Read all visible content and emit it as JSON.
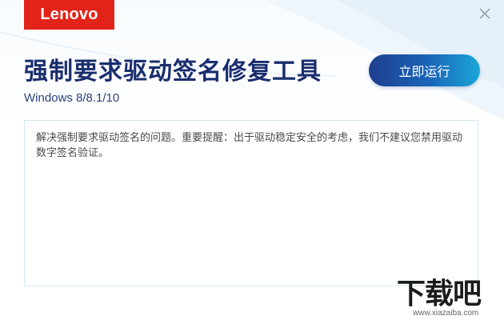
{
  "brand": {
    "logo_text": "Lenovo",
    "color": "#e2231a"
  },
  "window": {
    "close_icon": "close-icon"
  },
  "header": {
    "title": "强制要求驱动签名修复工具",
    "subtitle": "Windows 8/8.1/10"
  },
  "actions": {
    "run_label": "立即运行"
  },
  "info": {
    "text": "解决强制要求驱动签名的问题。重要提醒：出于驱动稳定安全的考虑，我们不建议您禁用驱动数字签名验证。"
  },
  "watermark": {
    "main": "下载吧",
    "url": "www.xiazaiba.com"
  },
  "colors": {
    "title": "#1a2e6e",
    "button_start": "#1f3f8e",
    "button_end": "#1aa7d8",
    "box_border": "#cfe6f1"
  }
}
